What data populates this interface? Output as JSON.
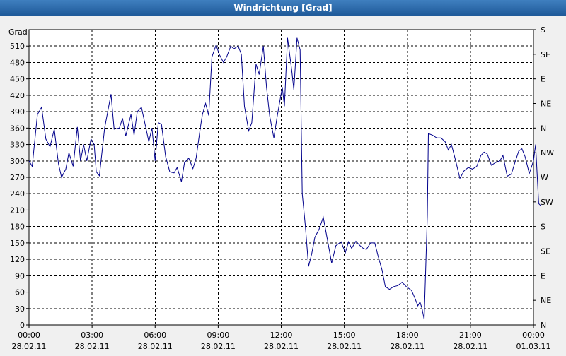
{
  "window": {
    "title": "Windrichtung [Grad]"
  },
  "chart_data": {
    "type": "line",
    "title": "Windrichtung [Grad]",
    "ylabel": "Grad",
    "ylim": [
      0,
      540
    ],
    "y_ticks": [
      0,
      30,
      60,
      90,
      120,
      150,
      180,
      210,
      240,
      270,
      300,
      330,
      360,
      390,
      420,
      450,
      480,
      510
    ],
    "y2_ticks": [
      {
        "v": 0,
        "label": "N"
      },
      {
        "v": 45,
        "label": "NE"
      },
      {
        "v": 90,
        "label": "E"
      },
      {
        "v": 135,
        "label": "SE"
      },
      {
        "v": 180,
        "label": "S"
      },
      {
        "v": 225,
        "label": "SW"
      },
      {
        "v": 270,
        "label": "W"
      },
      {
        "v": 315,
        "label": "NW"
      },
      {
        "v": 360,
        "label": "N"
      },
      {
        "v": 405,
        "label": "NE"
      },
      {
        "v": 450,
        "label": "E"
      },
      {
        "v": 495,
        "label": "SE"
      },
      {
        "v": 540,
        "label": "S"
      }
    ],
    "x_range_hours": [
      0,
      24
    ],
    "x_ticks": [
      {
        "h": 0,
        "time": "00:00",
        "date": "28.02.11"
      },
      {
        "h": 3,
        "time": "03:00",
        "date": "28.02.11"
      },
      {
        "h": 6,
        "time": "06:00",
        "date": "28.02.11"
      },
      {
        "h": 9,
        "time": "09:00",
        "date": "28.02.11"
      },
      {
        "h": 12,
        "time": "12:00",
        "date": "28.02.11"
      },
      {
        "h": 15,
        "time": "15:00",
        "date": "28.02.11"
      },
      {
        "h": 18,
        "time": "18:00",
        "date": "28.02.11"
      },
      {
        "h": 21,
        "time": "21:00",
        "date": "28.02.11"
      },
      {
        "h": 24,
        "time": "00:00",
        "date": "01.03.11"
      }
    ],
    "grid": true,
    "series": [
      {
        "color": "#00008b",
        "points": [
          [
            0.0,
            300
          ],
          [
            0.15,
            290
          ],
          [
            0.4,
            385
          ],
          [
            0.6,
            398
          ],
          [
            0.8,
            340
          ],
          [
            1.0,
            326
          ],
          [
            1.2,
            358
          ],
          [
            1.4,
            295
          ],
          [
            1.55,
            270
          ],
          [
            1.75,
            285
          ],
          [
            1.9,
            315
          ],
          [
            2.1,
            290
          ],
          [
            2.3,
            362
          ],
          [
            2.45,
            300
          ],
          [
            2.6,
            330
          ],
          [
            2.75,
            300
          ],
          [
            2.95,
            340
          ],
          [
            3.1,
            330
          ],
          [
            3.2,
            280
          ],
          [
            3.35,
            273
          ],
          [
            3.6,
            360
          ],
          [
            3.9,
            422
          ],
          [
            4.05,
            358
          ],
          [
            4.3,
            360
          ],
          [
            4.45,
            378
          ],
          [
            4.6,
            345
          ],
          [
            4.85,
            385
          ],
          [
            5.0,
            347
          ],
          [
            5.15,
            390
          ],
          [
            5.35,
            398
          ],
          [
            5.55,
            362
          ],
          [
            5.7,
            335
          ],
          [
            5.85,
            360
          ],
          [
            6.0,
            300
          ],
          [
            6.15,
            370
          ],
          [
            6.3,
            367
          ],
          [
            6.5,
            308
          ],
          [
            6.7,
            280
          ],
          [
            6.9,
            278
          ],
          [
            7.05,
            288
          ],
          [
            7.25,
            262
          ],
          [
            7.4,
            297
          ],
          [
            7.6,
            305
          ],
          [
            7.8,
            286
          ],
          [
            7.95,
            305
          ],
          [
            8.15,
            360
          ],
          [
            8.25,
            385
          ],
          [
            8.4,
            405
          ],
          [
            8.55,
            383
          ],
          [
            8.7,
            490
          ],
          [
            8.9,
            512
          ],
          [
            9.05,
            495
          ],
          [
            9.25,
            480
          ],
          [
            9.4,
            490
          ],
          [
            9.6,
            510
          ],
          [
            9.75,
            505
          ],
          [
            9.95,
            510
          ],
          [
            10.1,
            495
          ],
          [
            10.25,
            400
          ],
          [
            10.45,
            355
          ],
          [
            10.6,
            370
          ],
          [
            10.8,
            477
          ],
          [
            10.95,
            458
          ],
          [
            11.15,
            510
          ],
          [
            11.3,
            435
          ],
          [
            11.45,
            382
          ],
          [
            11.65,
            342
          ],
          [
            11.8,
            380
          ],
          [
            12.05,
            435
          ],
          [
            12.15,
            400
          ],
          [
            12.3,
            525
          ],
          [
            12.4,
            495
          ],
          [
            12.5,
            465
          ],
          [
            12.6,
            430
          ],
          [
            12.75,
            525
          ],
          [
            12.9,
            503
          ],
          [
            13.0,
            240
          ],
          [
            13.15,
            180
          ],
          [
            13.3,
            107
          ],
          [
            13.45,
            130
          ],
          [
            13.6,
            160
          ],
          [
            13.8,
            175
          ],
          [
            14.0,
            197
          ],
          [
            14.2,
            155
          ],
          [
            14.4,
            113
          ],
          [
            14.6,
            145
          ],
          [
            14.85,
            152
          ],
          [
            15.05,
            132
          ],
          [
            15.2,
            152
          ],
          [
            15.35,
            140
          ],
          [
            15.55,
            153
          ],
          [
            15.75,
            145
          ],
          [
            15.9,
            140
          ],
          [
            16.05,
            138
          ],
          [
            16.25,
            150
          ],
          [
            16.45,
            150
          ],
          [
            16.6,
            127
          ],
          [
            16.8,
            100
          ],
          [
            16.95,
            70
          ],
          [
            17.15,
            65
          ],
          [
            17.35,
            70
          ],
          [
            17.55,
            72
          ],
          [
            17.75,
            78
          ],
          [
            17.95,
            70
          ],
          [
            18.2,
            63
          ],
          [
            18.35,
            50
          ],
          [
            18.5,
            35
          ],
          [
            18.6,
            42
          ],
          [
            18.7,
            30
          ],
          [
            18.8,
            10
          ],
          [
            18.95,
            200
          ],
          [
            19.0,
            350
          ],
          [
            19.2,
            347
          ],
          [
            19.4,
            342
          ],
          [
            19.6,
            342
          ],
          [
            19.8,
            335
          ],
          [
            19.95,
            320
          ],
          [
            20.1,
            330
          ],
          [
            20.3,
            300
          ],
          [
            20.5,
            268
          ],
          [
            20.7,
            282
          ],
          [
            20.9,
            288
          ],
          [
            21.1,
            285
          ],
          [
            21.3,
            290
          ],
          [
            21.5,
            310
          ],
          [
            21.65,
            316
          ],
          [
            21.8,
            313
          ],
          [
            22.0,
            292
          ],
          [
            22.2,
            297
          ],
          [
            22.4,
            300
          ],
          [
            22.55,
            310
          ],
          [
            22.75,
            272
          ],
          [
            22.95,
            276
          ],
          [
            23.1,
            295
          ],
          [
            23.3,
            318
          ],
          [
            23.45,
            322
          ],
          [
            23.6,
            308
          ],
          [
            23.8,
            277
          ],
          [
            24.0,
            300
          ],
          [
            24.1,
            330
          ],
          [
            24.25,
            222
          ],
          [
            24.35,
            218
          ]
        ]
      }
    ]
  }
}
